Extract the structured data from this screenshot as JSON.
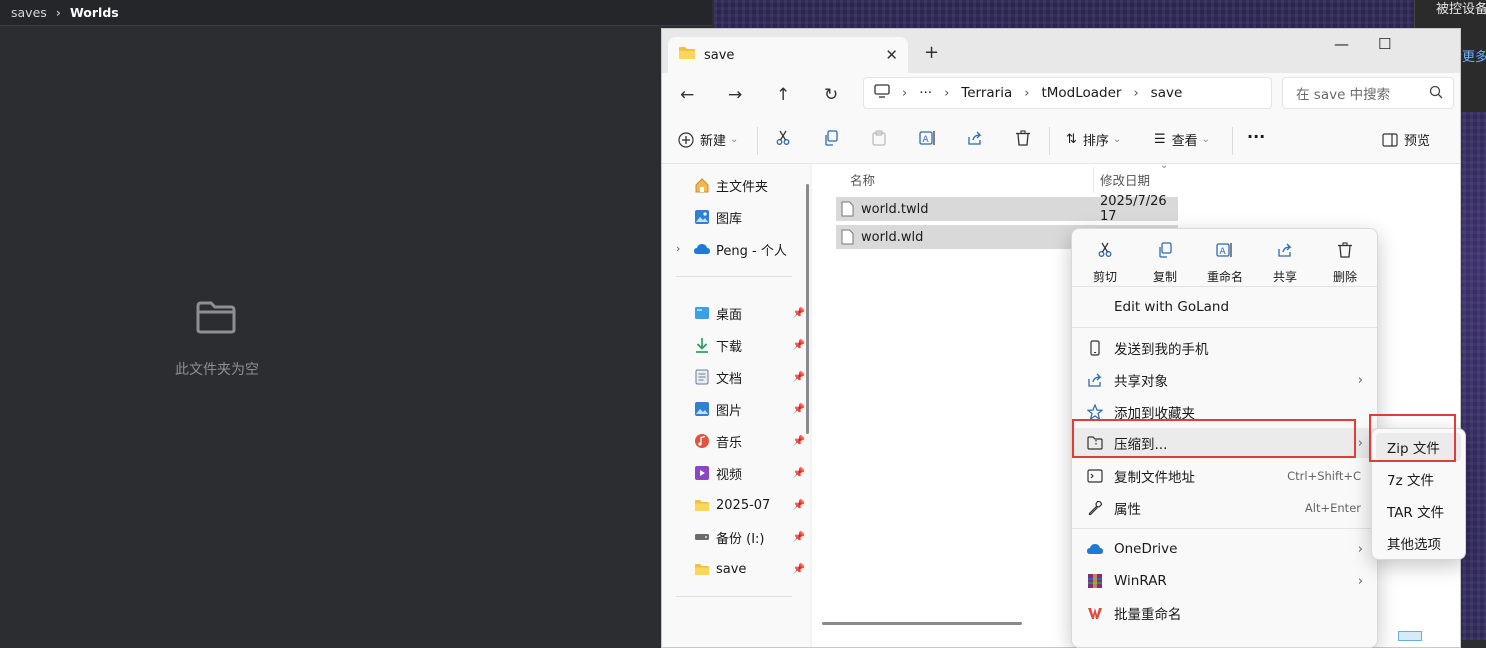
{
  "left_app": {
    "breadcrumb": [
      "saves",
      "Worlds"
    ],
    "empty_text": "此文件夹为空"
  },
  "notification": {
    "line1": "被控设备",
    "link": "查看更多"
  },
  "explorer": {
    "tab_title": "save",
    "new_tab": "+",
    "tab_close": "✕",
    "window_buttons": [
      "—",
      "☐"
    ],
    "address": {
      "more": "···",
      "segments": [
        "Terraria",
        "tModLoader",
        "save"
      ]
    },
    "search_placeholder": "在 save 中搜索",
    "toolbar": {
      "new": "新建",
      "sort": "排序",
      "view": "查看",
      "more": "···",
      "preview": "预览"
    },
    "sidebar": {
      "home": "主文件夹",
      "gallery": "图库",
      "onedrive": "Peng - 个人",
      "pinned": [
        {
          "label": "桌面",
          "icon": "desktop-icon"
        },
        {
          "label": "下载",
          "icon": "download-icon"
        },
        {
          "label": "文档",
          "icon": "document-icon"
        },
        {
          "label": "图片",
          "icon": "pictures-icon"
        },
        {
          "label": "音乐",
          "icon": "music-icon"
        },
        {
          "label": "视频",
          "icon": "video-icon"
        },
        {
          "label": "2025-07",
          "icon": "folder-icon"
        },
        {
          "label": "备份 (I:)",
          "icon": "drive-icon"
        },
        {
          "label": "save",
          "icon": "folder-icon"
        }
      ]
    },
    "columns": {
      "name": "名称",
      "modified": "修改日期"
    },
    "files": [
      {
        "name": "world.twld",
        "modified": "2025/7/26 17"
      },
      {
        "name": "world.wld",
        "modified": ""
      }
    ]
  },
  "context_menu": {
    "quick_actions": [
      {
        "label": "剪切",
        "icon": "cut-icon"
      },
      {
        "label": "复制",
        "icon": "copy-icon"
      },
      {
        "label": "重命名",
        "icon": "rename-icon"
      },
      {
        "label": "共享",
        "icon": "share-icon"
      },
      {
        "label": "删除",
        "icon": "delete-icon"
      }
    ],
    "edit_with": "Edit with GoLand",
    "send_to_phone": "发送到我的手机",
    "share_with": "共享对象",
    "add_favorite": "添加到收藏夹",
    "compress": "压缩到...",
    "copy_path": "复制文件地址",
    "copy_path_shortcut": "Ctrl+Shift+C",
    "properties": "属性",
    "properties_shortcut": "Alt+Enter",
    "onedrive": "OneDrive",
    "winrar": "WinRAR",
    "batch_rename": "批量重命名"
  },
  "compress_submenu": [
    "Zip 文件",
    "7z 文件",
    "TAR 文件",
    "其他选项"
  ],
  "colors": {
    "highlight_box": "#e03c3c",
    "selection": "#d9d9d9",
    "link": "#6fb0ff"
  }
}
